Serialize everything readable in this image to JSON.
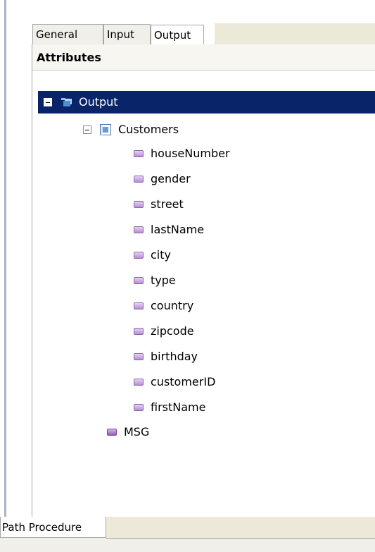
{
  "tabs": {
    "general": "General",
    "input": "Input",
    "output": "Output"
  },
  "panel": {
    "header": "Attributes"
  },
  "tree": {
    "root_label": "Output",
    "group_label": "Customers",
    "attributes": [
      "houseNumber",
      "gender",
      "street",
      "lastName",
      "city",
      "type",
      "country",
      "zipcode",
      "birthday",
      "customerID",
      "firstName"
    ],
    "msg_label": "MSG"
  },
  "bottom_tabs": {
    "path_procedure": "Path Procedure"
  },
  "icons": {
    "root_toggle": "collapse-icon",
    "group_toggle": "collapse-icon",
    "root_icon": "output-icon",
    "group_icon": "customers-icon",
    "attribute_icon": "attribute-icon",
    "msg_icon": "message-icon"
  },
  "colors": {
    "selection": "#0a246a",
    "attribute_fill": "#b68ed3",
    "msg_fill": "#8f5dbb"
  }
}
